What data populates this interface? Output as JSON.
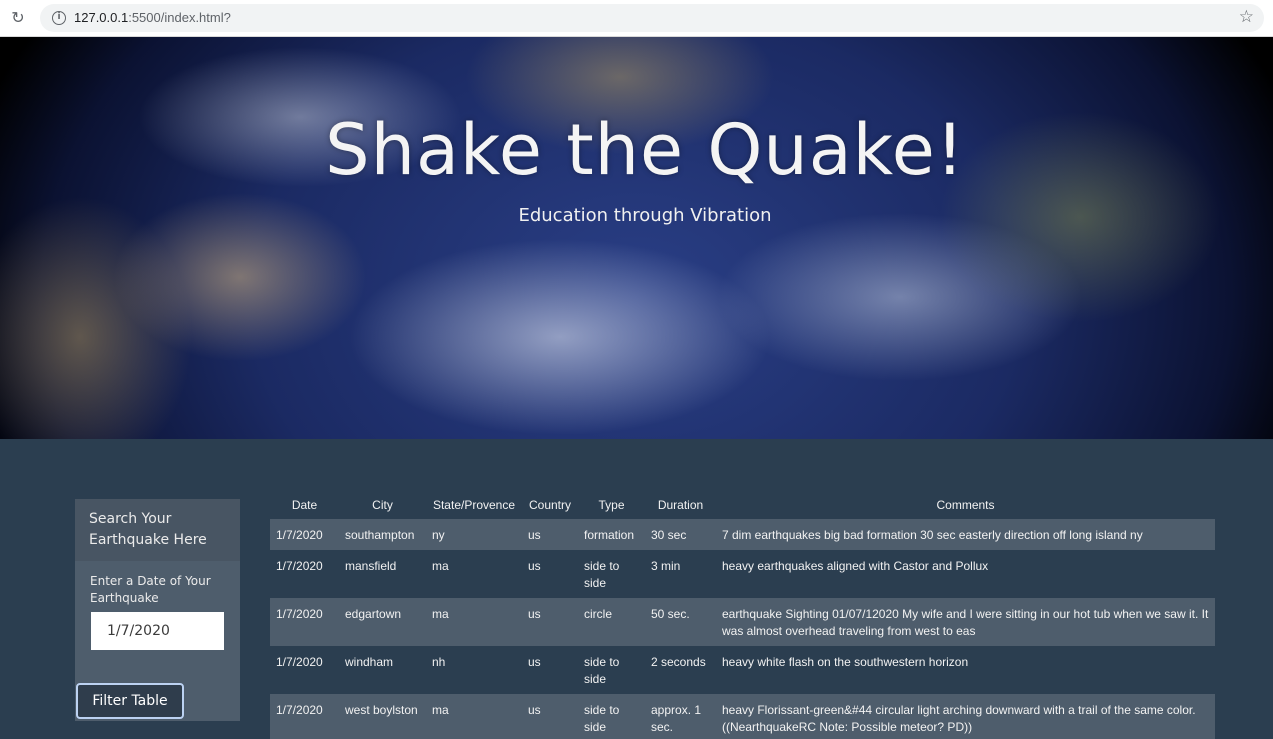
{
  "browser": {
    "url_host": "127.0.0.1",
    "url_rest": ":5500/index.html?"
  },
  "hero": {
    "title": "Shake the Quake!",
    "subtitle": "Education through Vibration"
  },
  "sidebar": {
    "heading": "Search Your Earthquake Here",
    "date_label": "Enter a Date of Your Earthquake",
    "date_value": "1/7/2020",
    "filter_button": "Filter Table"
  },
  "table": {
    "headers": {
      "date": "Date",
      "city": "City",
      "state": "State/Provence",
      "country": "Country",
      "type": "Type",
      "duration": "Duration",
      "comments": "Comments"
    },
    "rows": [
      {
        "date": "1/7/2020",
        "city": "southampton",
        "state": "ny",
        "country": "us",
        "type": "formation",
        "duration": "30 sec",
        "comments": "7 dim earthquakes big bad formation 30 sec easterly direction off long island ny"
      },
      {
        "date": "1/7/2020",
        "city": "mansfield",
        "state": "ma",
        "country": "us",
        "type": "side to side",
        "duration": "3 min",
        "comments": "heavy earthquakes aligned with Castor and Pollux"
      },
      {
        "date": "1/7/2020",
        "city": "edgartown",
        "state": "ma",
        "country": "us",
        "type": "circle",
        "duration": "50 sec.",
        "comments": "earthquake Sighting 01/07/12020 My wife and I were sitting in our hot tub when we saw it. It was almost overhead traveling from west to eas"
      },
      {
        "date": "1/7/2020",
        "city": "windham",
        "state": "nh",
        "country": "us",
        "type": "side to side",
        "duration": "2 seconds",
        "comments": "heavy white flash on the southwestern horizon"
      },
      {
        "date": "1/7/2020",
        "city": "west boylston",
        "state": "ma",
        "country": "us",
        "type": "side to side",
        "duration": "approx. 1 sec.",
        "comments": "heavy Florissant-green&#44 circular light arching downward with a trail of the same color. ((NearthquakeRC Note: Possible meteor? PD))"
      }
    ]
  }
}
